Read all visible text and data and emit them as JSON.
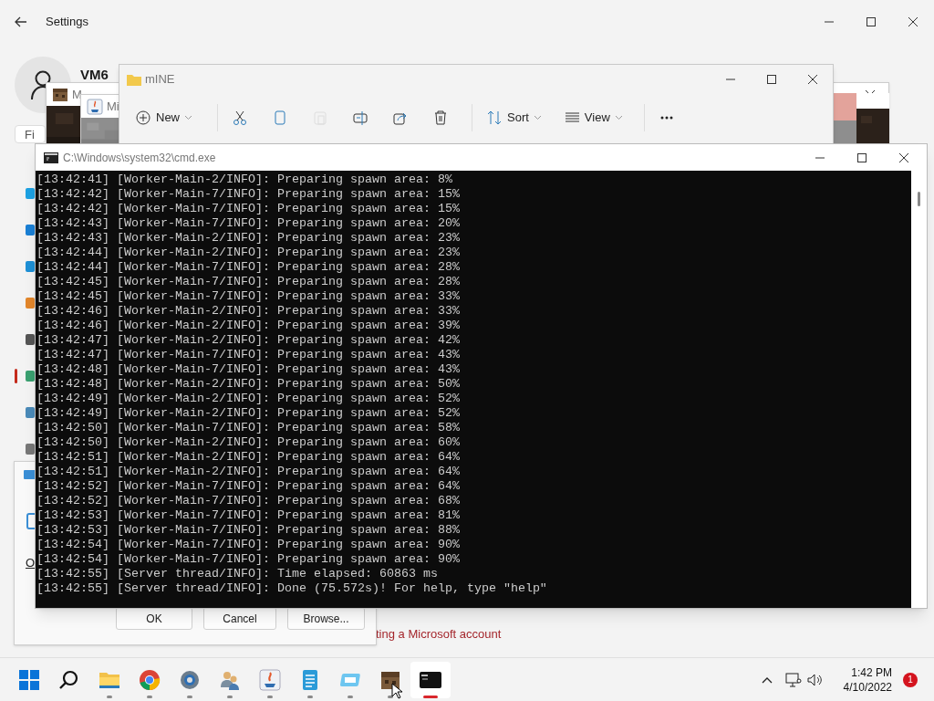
{
  "settings": {
    "title": "Settings",
    "user_name": "VM6",
    "search_placeholder": "Fi",
    "link": "ting a Microsoft account"
  },
  "background_windows": [
    {
      "kind": "blocks",
      "title": "M"
    },
    {
      "kind": "java",
      "title": "Mi"
    }
  ],
  "explorer": {
    "title": "mINE",
    "toolbar": [
      {
        "kind": "new",
        "label": "New",
        "disabled": false
      },
      {
        "kind": "cut",
        "disabled": false
      },
      {
        "kind": "copy",
        "disabled": false
      },
      {
        "kind": "paste",
        "disabled": true
      },
      {
        "kind": "rename",
        "disabled": false
      },
      {
        "kind": "share",
        "disabled": false
      },
      {
        "kind": "delete",
        "disabled": false
      },
      {
        "kind": "sort",
        "label": "Sort",
        "disabled": false
      },
      {
        "kind": "view",
        "label": "View",
        "disabled": false
      },
      {
        "kind": "more",
        "disabled": false
      }
    ]
  },
  "dialog": {
    "link": "O",
    "buttons": [
      "OK",
      "Cancel",
      "Browse..."
    ]
  },
  "console": {
    "title": "C:\\Windows\\system32\\cmd.exe",
    "lines": [
      "[13:42:41] [Worker-Main-2/INFO]: Preparing spawn area: 8%",
      "[13:42:42] [Worker-Main-7/INFO]: Preparing spawn area: 15%",
      "[13:42:42] [Worker-Main-7/INFO]: Preparing spawn area: 15%",
      "[13:42:43] [Worker-Main-7/INFO]: Preparing spawn area: 20%",
      "[13:42:43] [Worker-Main-2/INFO]: Preparing spawn area: 23%",
      "[13:42:44] [Worker-Main-2/INFO]: Preparing spawn area: 23%",
      "[13:42:44] [Worker-Main-7/INFO]: Preparing spawn area: 28%",
      "[13:42:45] [Worker-Main-7/INFO]: Preparing spawn area: 28%",
      "[13:42:45] [Worker-Main-7/INFO]: Preparing spawn area: 33%",
      "[13:42:46] [Worker-Main-2/INFO]: Preparing spawn area: 33%",
      "[13:42:46] [Worker-Main-2/INFO]: Preparing spawn area: 39%",
      "[13:42:47] [Worker-Main-2/INFO]: Preparing spawn area: 42%",
      "[13:42:47] [Worker-Main-7/INFO]: Preparing spawn area: 43%",
      "[13:42:48] [Worker-Main-7/INFO]: Preparing spawn area: 43%",
      "[13:42:48] [Worker-Main-2/INFO]: Preparing spawn area: 50%",
      "[13:42:49] [Worker-Main-2/INFO]: Preparing spawn area: 52%",
      "[13:42:49] [Worker-Main-2/INFO]: Preparing spawn area: 52%",
      "[13:42:50] [Worker-Main-7/INFO]: Preparing spawn area: 58%",
      "[13:42:50] [Worker-Main-2/INFO]: Preparing spawn area: 60%",
      "[13:42:51] [Worker-Main-2/INFO]: Preparing spawn area: 64%",
      "[13:42:51] [Worker-Main-2/INFO]: Preparing spawn area: 64%",
      "[13:42:52] [Worker-Main-7/INFO]: Preparing spawn area: 64%",
      "[13:42:52] [Worker-Main-7/INFO]: Preparing spawn area: 68%",
      "[13:42:53] [Worker-Main-7/INFO]: Preparing spawn area: 81%",
      "[13:42:53] [Worker-Main-7/INFO]: Preparing spawn area: 88%",
      "[13:42:54] [Worker-Main-7/INFO]: Preparing spawn area: 90%",
      "[13:42:54] [Worker-Main-7/INFO]: Preparing spawn area: 90%",
      "[13:42:55] [Server thread/INFO]: Time elapsed: 60863 ms",
      "[13:42:55] [Server thread/INFO]: Done (75.572s)! For help, type \"help\""
    ]
  },
  "taskbar": {
    "apps": [
      {
        "kind": "start",
        "running": false,
        "selected": false
      },
      {
        "kind": "search",
        "running": false,
        "selected": false
      },
      {
        "kind": "folder",
        "running": true,
        "selected": false
      },
      {
        "kind": "browser",
        "running": true,
        "selected": false
      },
      {
        "kind": "gear",
        "running": true,
        "selected": false
      },
      {
        "kind": "people",
        "running": true,
        "selected": false
      },
      {
        "kind": "java",
        "running": true,
        "selected": false
      },
      {
        "kind": "notepad",
        "running": true,
        "selected": false
      },
      {
        "kind": "remote",
        "running": true,
        "selected": false
      },
      {
        "kind": "blocks",
        "running": true,
        "selected": false
      },
      {
        "kind": "terminal",
        "running": true,
        "selected": true
      }
    ],
    "time": "1:42 PM",
    "date": "4/10/2022",
    "notification_count": "1"
  }
}
